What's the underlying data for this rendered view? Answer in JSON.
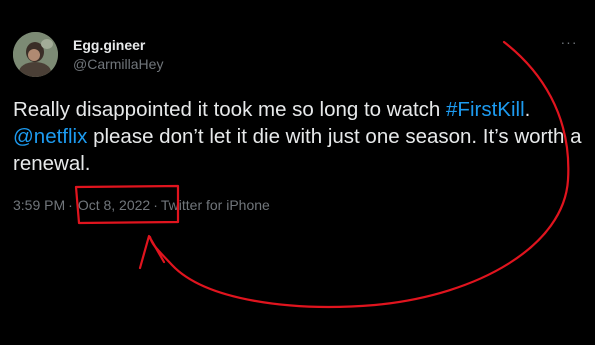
{
  "tweet": {
    "display_name": "Egg.gineer",
    "handle": "@CarmillaHey",
    "more_icon": "···",
    "text_before": "Really disappointed it took me so long to watch ",
    "hashtag": "#FirstKill",
    "text_mid1": ". ",
    "mention": "@netflix",
    "text_after": " please don’t let it die with just one season. It’s worth a renewal.",
    "time": "3:59 PM",
    "separator": "·",
    "date": "Oct 8, 2022",
    "source": "Twitter for iPhone"
  },
  "colors": {
    "background": "#000000",
    "text": "#e7e9ea",
    "muted": "#71767b",
    "link": "#1d9bf0",
    "annotation": "#e0141e"
  },
  "icons": {
    "avatar": "avatar-photo",
    "more": "more-options-icon"
  }
}
